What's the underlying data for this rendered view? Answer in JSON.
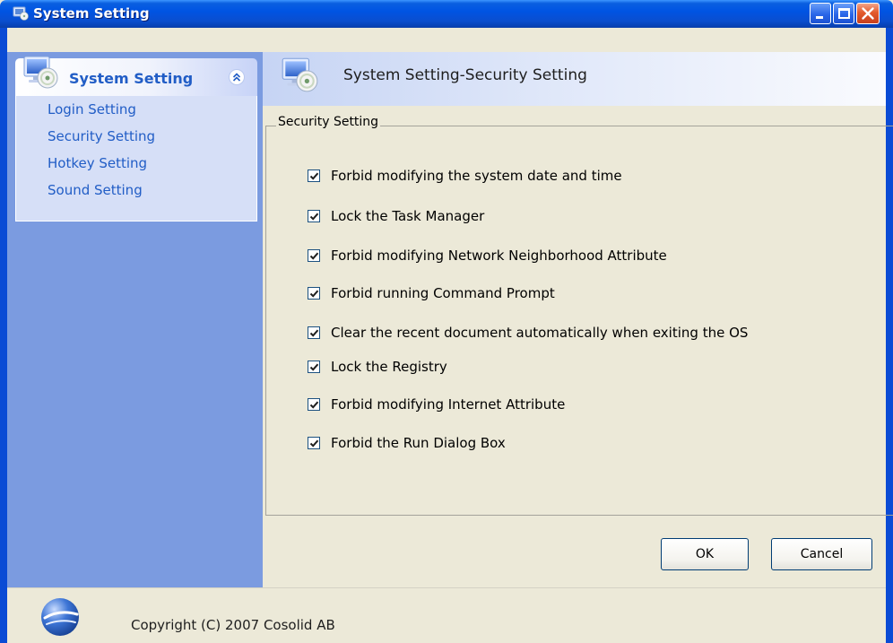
{
  "window": {
    "title": "System Setting",
    "buttons": {
      "minimize": "minimize",
      "maximize": "maximize",
      "close": "close"
    }
  },
  "sidebar": {
    "title": "System Setting",
    "items": [
      {
        "label": "Login Setting"
      },
      {
        "label": "Security Setting"
      },
      {
        "label": "Hotkey Setting"
      },
      {
        "label": "Sound Setting"
      }
    ]
  },
  "main": {
    "title": "System Setting-Security Setting",
    "group_label": "Security Setting",
    "options": [
      {
        "label": "Forbid modifying the system date and time",
        "checked": true
      },
      {
        "label": "Lock the Task Manager",
        "checked": true
      },
      {
        "label": "Forbid modifying Network Neighborhood Attribute",
        "checked": true
      },
      {
        "label": "Forbid running Command Prompt",
        "checked": true
      },
      {
        "label": "Clear the recent document automatically when exiting the OS",
        "checked": true
      },
      {
        "label": "Lock the Registry",
        "checked": true
      },
      {
        "label": "Forbid modifying Internet Attribute",
        "checked": true
      },
      {
        "label": "Forbid the Run Dialog Box",
        "checked": true
      }
    ],
    "ok_label": "OK",
    "cancel_label": "Cancel"
  },
  "footer": {
    "copyright": "Copyright (C) 2007 Cosolid AB"
  },
  "colors": {
    "title_bar": "#0054e3",
    "sidebar_bg": "#7b9be0",
    "sidebar_link": "#215dc6",
    "window_bg": "#ece9d8"
  },
  "icons": {
    "app": "monitor-disc-icon",
    "sidebar_header": "monitor-disc-icon",
    "collapse": "chevron-double-up-icon",
    "main_header": "monitor-disc-icon",
    "footer_logo": "cosolid-globe-logo",
    "checkbox": "checkmark-icon"
  }
}
